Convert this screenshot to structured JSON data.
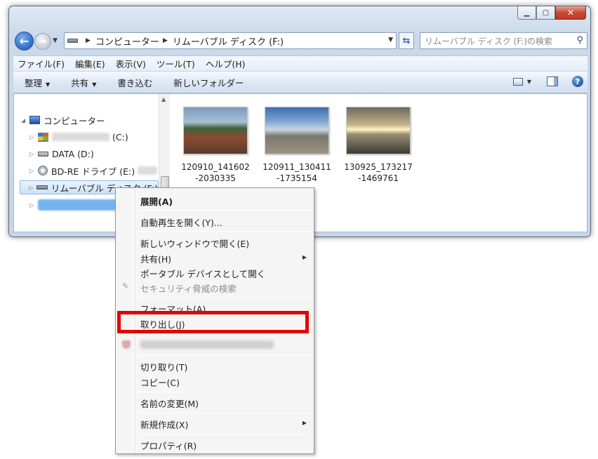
{
  "address": {
    "segments": [
      "コンピューター",
      "リムーバブル ディスク (F:)"
    ]
  },
  "search": {
    "placeholder": "リムーバブル ディスク (F:)の検索"
  },
  "menu_bar": [
    "ファイル(F)",
    "編集(E)",
    "表示(V)",
    "ツール(T)",
    "ヘルプ(H)"
  ],
  "command_bar": {
    "organize": "整理",
    "share": "共有",
    "burn": "書き込む",
    "new_folder": "新しいフォルダー"
  },
  "nav_tree": {
    "computer": "コンピューター",
    "c_drive_suffix": "(C:)",
    "d_drive": "DATA (D:)",
    "e_drive": "BD-RE ドライブ (E:)",
    "f_drive": "リムーバブル ディスク (F:)"
  },
  "files": [
    {
      "name_line1": "120910_141602",
      "name_line2": "-2030335"
    },
    {
      "name_line1": "120911_130411",
      "name_line2": "-1735154"
    },
    {
      "name_line1": "130925_173217",
      "name_line2": "-1469761"
    }
  ],
  "context_menu": {
    "expand": "展開(A)",
    "autoplay": "自動再生を開く(Y)...",
    "open_new_window": "新しいウィンドウで開く(E)",
    "share": "共有(H)",
    "open_portable": "ポータブル デバイスとして開く",
    "security_scan": "セキュリティ脅威の検索",
    "format": "フォーマット(A)...",
    "eject": "取り出し(J)",
    "cut": "切り取り(T)",
    "copy": "コピー(C)",
    "rename": "名前の変更(M)",
    "new": "新規作成(X)",
    "properties": "プロパティ(R)"
  },
  "colors": {
    "highlight_box": "#e60000",
    "selection": "#cbe2f8"
  }
}
